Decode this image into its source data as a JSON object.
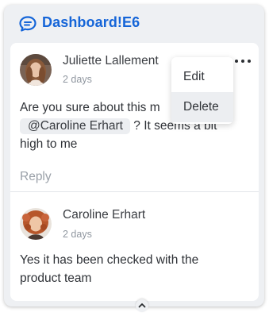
{
  "header": {
    "title": "Dashboard!E6",
    "icon": "comment-icon",
    "accent_color": "#1565d8"
  },
  "comments": [
    {
      "author": "Juliette Lallement",
      "time": "2 days",
      "text_before": "Are you sure about this m",
      "mention": "@Caroline Erhart",
      "text_after_mention": "? It seems a bit",
      "text_line3": "high to me",
      "reply_label": "Reply"
    },
    {
      "author": "Caroline Erhart",
      "time": "2 days",
      "text_line1": "Yes it has been checked with the",
      "text_line2": "product team"
    }
  ],
  "context_menu": {
    "items": [
      "Edit",
      "Delete"
    ],
    "highlighted": "Delete"
  },
  "more_icon": "more-horizontal-icon",
  "collapse_icon": "chevron-up-icon"
}
